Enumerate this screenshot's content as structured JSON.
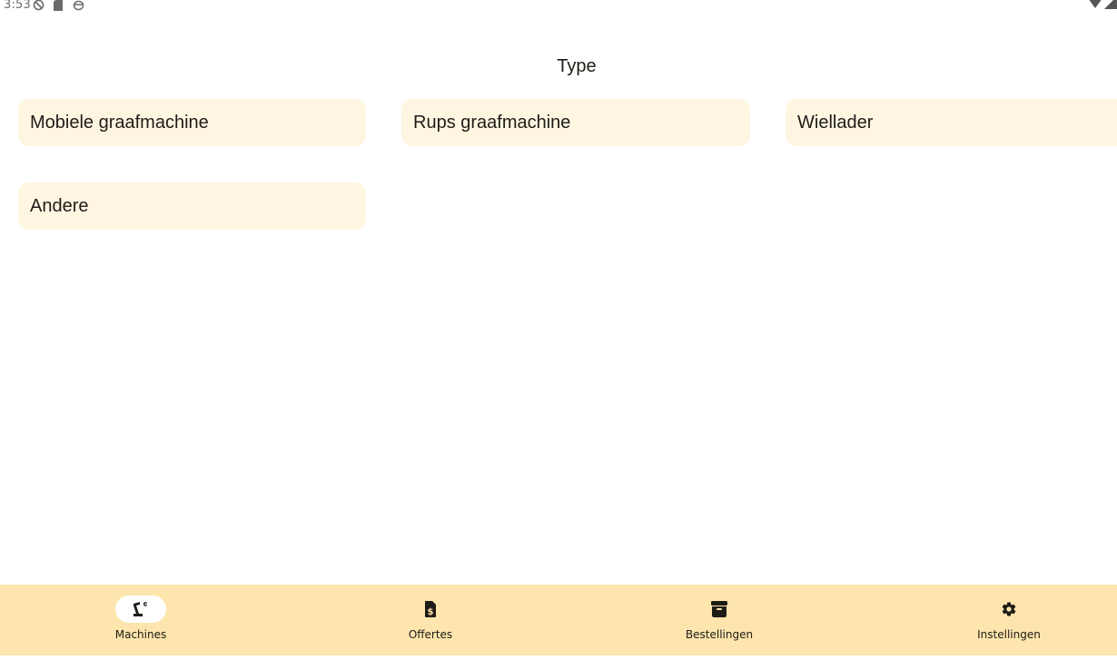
{
  "status_bar": {
    "time": "3:53",
    "icons": [
      "do-not-disturb-icon",
      "sd-card-icon",
      "debug-icon"
    ],
    "right_icons": [
      "wifi-icon",
      "signal-icon"
    ]
  },
  "page": {
    "title": "Type"
  },
  "types": [
    {
      "label": "Mobiele graafmachine"
    },
    {
      "label": "Rups graafmachine"
    },
    {
      "label": "Wiellader"
    },
    {
      "label": "Andere"
    }
  ],
  "bottom_nav": {
    "items": [
      {
        "label": "Machines",
        "icon": "excavator-icon",
        "active": true
      },
      {
        "label": "Offertes",
        "icon": "invoice-dollar-icon",
        "active": false
      },
      {
        "label": "Bestellingen",
        "icon": "archive-box-icon",
        "active": false
      },
      {
        "label": "Instellingen",
        "icon": "gear-icon",
        "active": false
      }
    ]
  },
  "colors": {
    "button_bg": "#fff6e2",
    "nav_bg": "#fde5ad",
    "text": "#1f1b16"
  }
}
